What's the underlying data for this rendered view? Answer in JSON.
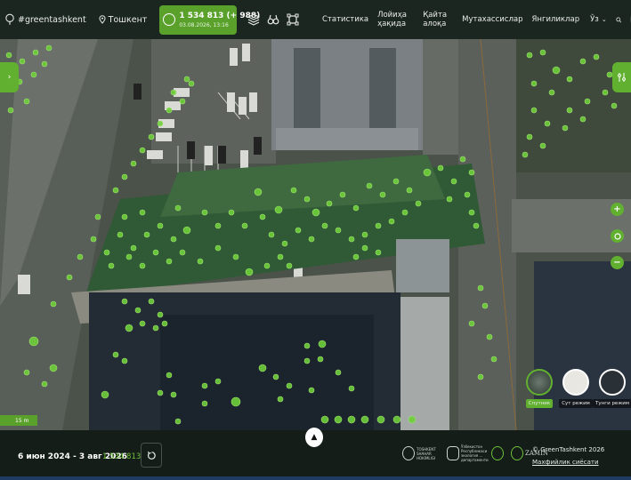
{
  "header": {
    "logo_text": "#greentashkent",
    "city": "Тошкент",
    "counter_value": "1 534 813 (+ 988)",
    "counter_date": "03.08.2026, 13:16",
    "nav": [
      "Статистика",
      "Лойиҳа ҳақида",
      "Қайта алоқа",
      "Мутахассислар",
      "Янгиликлар"
    ],
    "language": "Ўз"
  },
  "map": {
    "scale_label": "15 m",
    "layers": [
      {
        "label": "Спутник",
        "active": true
      },
      {
        "label": "Сут режим",
        "active": false
      },
      {
        "label": "Тунги режим",
        "active": false
      }
    ],
    "tree_marker_color": "#6fcf3a"
  },
  "footer": {
    "date_range": "6 июн 2024 - 3 авг 2026",
    "date_count": "1 534 813",
    "partner_1": "TOSHKENT SHAHAR HOKIMLIGI",
    "partner_2": "Ўзбекистон Республикаси экология ... департаменти",
    "partner_3": "ZAMIN",
    "copyright": "© GreenTashkent 2026",
    "privacy": "Махфийлик сиёсати"
  },
  "colors": {
    "accent": "#5aa12c",
    "topbar": "#1c2620",
    "bottombar": "#141d17"
  }
}
